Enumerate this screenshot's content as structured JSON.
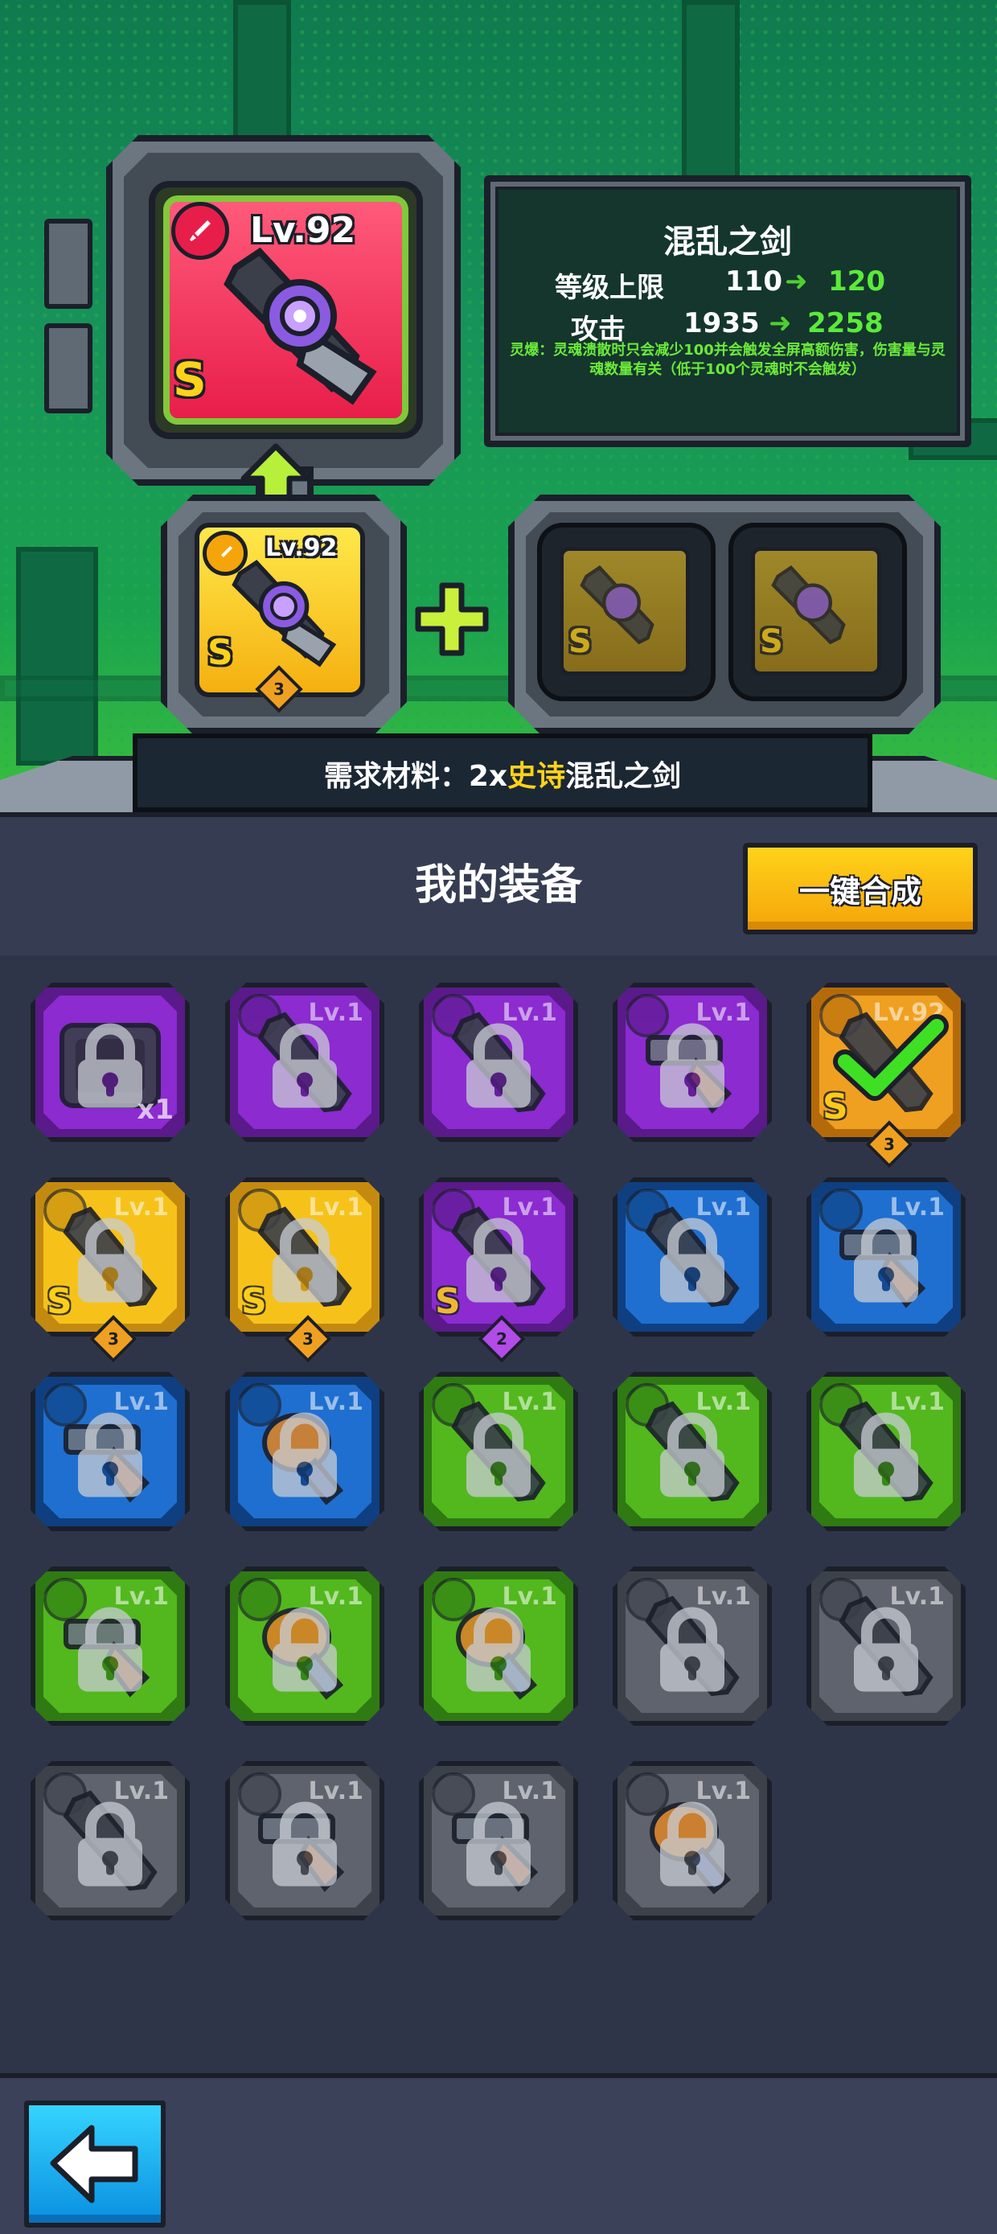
{
  "target": {
    "level": "Lv.92",
    "rank": "S"
  },
  "info": {
    "name": "混乱之剑",
    "level_cap_label": "等级上限",
    "level_cap_from": "110",
    "level_cap_to": "120",
    "attack_label": "攻击",
    "attack_from": "1935",
    "attack_to": "2258",
    "description": "灵爆：灵魂溃散时只会减少100并会触发全屏高额伤害，伤害量与灵魂数量有关（低于100个灵魂时不会触发）"
  },
  "source": {
    "level": "Lv.92",
    "rank": "S",
    "stars": "3"
  },
  "materials": [
    {
      "rank": "S"
    },
    {
      "rank": "S"
    }
  ],
  "requirement": {
    "prefix": "需求材料：",
    "count": "2x",
    "rarity": "史诗",
    "item": "混乱之剑"
  },
  "header": {
    "title": "我的装备",
    "merge_button": "一键合成"
  },
  "inventory": [
    {
      "rarity": "purple",
      "type": "chest",
      "level": "",
      "quantity": "x1",
      "rank": "",
      "stars": ""
    },
    {
      "rarity": "purple",
      "type": "sword",
      "level": "Lv.1",
      "quantity": "",
      "rank": "",
      "stars": ""
    },
    {
      "rarity": "purple",
      "type": "sword",
      "level": "Lv.1",
      "quantity": "",
      "rank": "",
      "stars": ""
    },
    {
      "rarity": "purple",
      "type": "gun",
      "level": "Lv.1",
      "quantity": "",
      "rank": "",
      "stars": ""
    },
    {
      "rarity": "orange",
      "type": "sword",
      "level": "Lv.92",
      "quantity": "",
      "rank": "S",
      "stars": "3",
      "selected": true
    },
    {
      "rarity": "yellow",
      "type": "sword",
      "level": "Lv.1",
      "quantity": "",
      "rank": "S",
      "stars": "3"
    },
    {
      "rarity": "yellow",
      "type": "sword",
      "level": "Lv.1",
      "quantity": "",
      "rank": "S",
      "stars": "3"
    },
    {
      "rarity": "purple",
      "type": "sword",
      "level": "Lv.1",
      "quantity": "",
      "rank": "S",
      "stars": "2"
    },
    {
      "rarity": "blue",
      "type": "sword",
      "level": "Lv.1",
      "quantity": "",
      "rank": "",
      "stars": ""
    },
    {
      "rarity": "blue",
      "type": "gun",
      "level": "Lv.1",
      "quantity": "",
      "rank": "",
      "stars": ""
    },
    {
      "rarity": "blue",
      "type": "gun",
      "level": "Lv.1",
      "quantity": "",
      "rank": "",
      "stars": ""
    },
    {
      "rarity": "blue",
      "type": "club",
      "level": "Lv.1",
      "quantity": "",
      "rank": "",
      "stars": ""
    },
    {
      "rarity": "green",
      "type": "sword",
      "level": "Lv.1",
      "quantity": "",
      "rank": "",
      "stars": ""
    },
    {
      "rarity": "green",
      "type": "sword",
      "level": "Lv.1",
      "quantity": "",
      "rank": "",
      "stars": ""
    },
    {
      "rarity": "green",
      "type": "sword",
      "level": "Lv.1",
      "quantity": "",
      "rank": "",
      "stars": ""
    },
    {
      "rarity": "green",
      "type": "gun",
      "level": "Lv.1",
      "quantity": "",
      "rank": "",
      "stars": ""
    },
    {
      "rarity": "green",
      "type": "club",
      "level": "Lv.1",
      "quantity": "",
      "rank": "",
      "stars": ""
    },
    {
      "rarity": "green",
      "type": "club",
      "level": "Lv.1",
      "quantity": "",
      "rank": "",
      "stars": ""
    },
    {
      "rarity": "gray",
      "type": "sword",
      "level": "Lv.1",
      "quantity": "",
      "rank": "",
      "stars": ""
    },
    {
      "rarity": "gray",
      "type": "sword",
      "level": "Lv.1",
      "quantity": "",
      "rank": "",
      "stars": ""
    },
    {
      "rarity": "gray",
      "type": "sword",
      "level": "Lv.1",
      "quantity": "",
      "rank": "",
      "stars": ""
    },
    {
      "rarity": "gray",
      "type": "gun",
      "level": "Lv.1",
      "quantity": "",
      "rank": "",
      "stars": ""
    },
    {
      "rarity": "gray",
      "type": "gun",
      "level": "Lv.1",
      "quantity": "",
      "rank": "",
      "stars": ""
    },
    {
      "rarity": "gray",
      "type": "club",
      "level": "Lv.1",
      "quantity": "",
      "rank": "",
      "stars": ""
    }
  ],
  "colors": {
    "purple": "#8b2bd0",
    "orange": "#f0a020",
    "yellow": "#f6c21a",
    "blue": "#1f6fd0",
    "green": "#52b81e",
    "gray": "#5e636e",
    "accent_green": "#5bea3a",
    "button_yellow": "#ffc21a",
    "back_blue": "#1aa8f0"
  },
  "icons": {
    "type_badge": "sword-type-icon",
    "lock": "lock-icon",
    "check": "check-mark-icon",
    "back": "back-arrow-icon"
  }
}
